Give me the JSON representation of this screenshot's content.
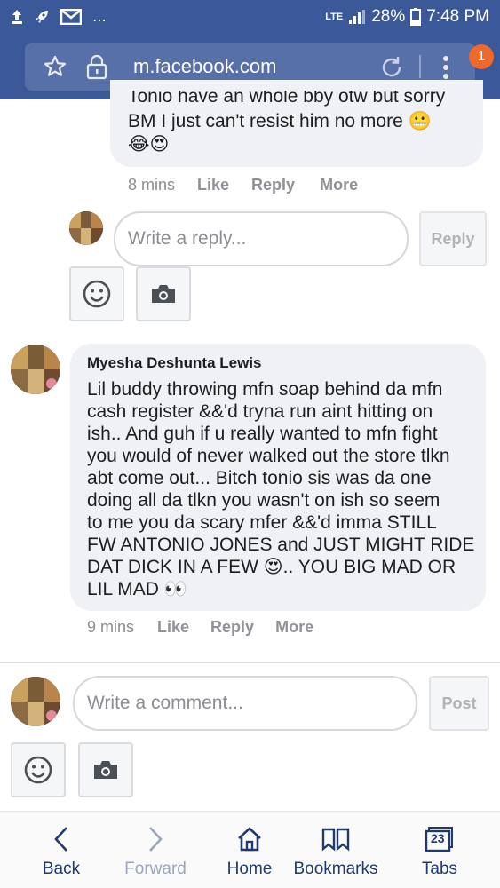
{
  "status_bar": {
    "network": "LTE",
    "battery": "28%",
    "time": "7:48 PM",
    "icons": [
      "upload-icon",
      "rocket-icon",
      "gmail-icon",
      "more-icon"
    ],
    "ellipsis": "..."
  },
  "browser": {
    "url": "m.facebook.com",
    "menu_badge": "1"
  },
  "comment1": {
    "partial_line": "Tonio have an whole bby otw but sorry",
    "line2": "BM I just can't resist him no more 😬",
    "line3": "😂😍",
    "time": "8 mins",
    "like": "Like",
    "reply": "Reply",
    "more": "More"
  },
  "reply_box": {
    "placeholder": "Write a reply...",
    "button": "Reply"
  },
  "comment2": {
    "author": "Myesha Deshunta Lewis",
    "lines": [
      "Lil buddy throwing mfn soap behind da mfn",
      "cash register &&'d tryna run aint hitting on",
      "ish.. And guh if u really wanted to mfn fight",
      "you would of never walked out the store tlkn",
      "abt come out... Bitch tonio sis was da one",
      "doing all da tlkn you wasn't on ish so seem",
      "to me you da scary mfer &&'d imma STILL",
      "FW ANTONIO JONES and JUST MIGHT RIDE",
      "DAT DICK IN A FEW 😍.. YOU BIG MAD OR",
      "LIL MAD 👀"
    ],
    "time": "9 mins",
    "like": "Like",
    "reply": "Reply",
    "more": "More"
  },
  "comment_box": {
    "placeholder": "Write a comment...",
    "button": "Post"
  },
  "bottom_nav": {
    "back": "Back",
    "forward": "Forward",
    "home": "Home",
    "bookmarks": "Bookmarks",
    "tabs": "Tabs",
    "tab_count": "23"
  },
  "colors": {
    "brand": "#3b5998",
    "url_box": "#5870a8",
    "bubble": "#f0f1f4",
    "badge": "#f0682a",
    "nav_text": "#1f3a6e"
  }
}
